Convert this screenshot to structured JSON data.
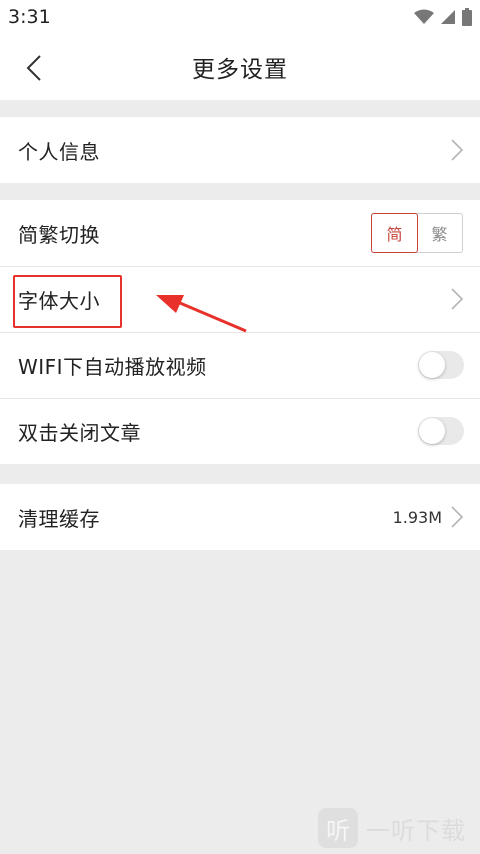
{
  "status_bar": {
    "time": "3:31",
    "icons": [
      "wifi-icon",
      "signal-icon",
      "battery-icon"
    ]
  },
  "header": {
    "title": "更多设置",
    "back_icon": "chevron-left-icon"
  },
  "sections": {
    "personal": {
      "label": "个人信息"
    },
    "display": {
      "convert": {
        "label": "简繁切换",
        "options": [
          "简",
          "繁"
        ],
        "selected": "简"
      },
      "font_size": {
        "label": "字体大小"
      },
      "wifi_autoplay": {
        "label": "WIFI下自动播放视频",
        "enabled": false
      },
      "double_tap_close": {
        "label": "双击关闭文章",
        "enabled": false
      }
    },
    "cache": {
      "label": "清理缓存",
      "value": "1.93M"
    }
  },
  "annotation": {
    "color": "#e8312b"
  },
  "watermark": {
    "logo": "听",
    "text": "一听下载"
  },
  "colors": {
    "accent": "#c6453b",
    "background": "#ececec",
    "card": "#ffffff"
  }
}
